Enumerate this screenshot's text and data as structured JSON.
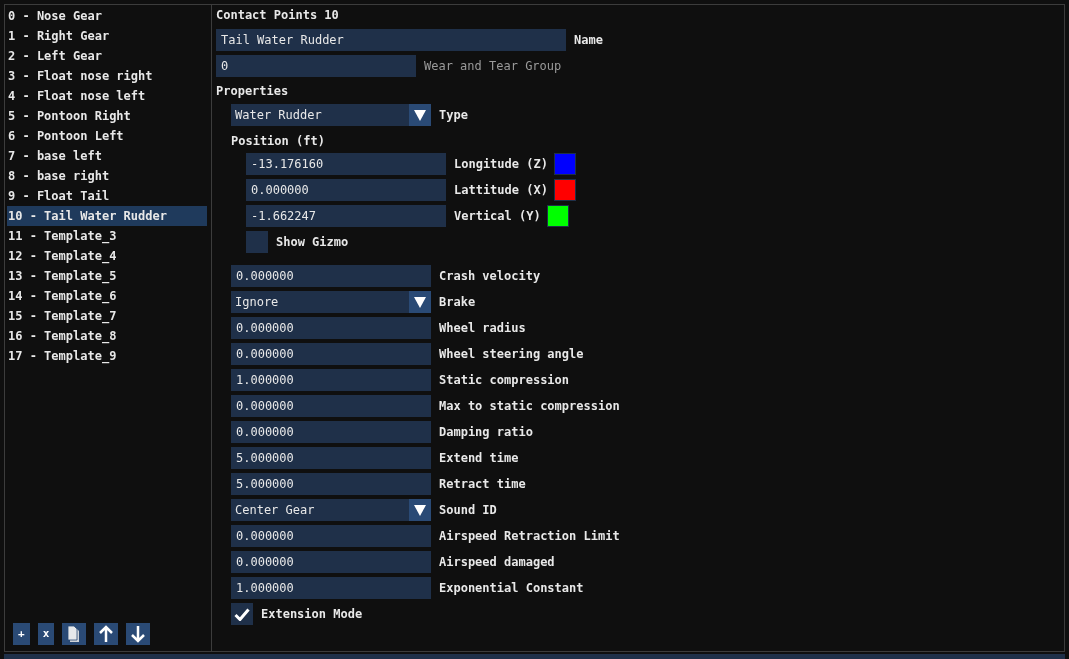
{
  "contact_list": {
    "items": [
      {
        "label": "0 - Nose Gear",
        "selected": false
      },
      {
        "label": "1 - Right Gear",
        "selected": false
      },
      {
        "label": "2 - Left Gear",
        "selected": false
      },
      {
        "label": "3 - Float nose right",
        "selected": false
      },
      {
        "label": "4 - Float nose left",
        "selected": false
      },
      {
        "label": "5 - Pontoon Right",
        "selected": false
      },
      {
        "label": "6 - Pontoon Left",
        "selected": false
      },
      {
        "label": "7 - base left",
        "selected": false
      },
      {
        "label": "8 - base right",
        "selected": false
      },
      {
        "label": "9 - Float Tail",
        "selected": false
      },
      {
        "label": "10 - Tail Water Rudder",
        "selected": true
      },
      {
        "label": "11 - Template_3",
        "selected": false
      },
      {
        "label": "12 - Template_4",
        "selected": false
      },
      {
        "label": "13 - Template_5",
        "selected": false
      },
      {
        "label": "14 - Template_6",
        "selected": false
      },
      {
        "label": "15 - Template_7",
        "selected": false
      },
      {
        "label": "16 - Template_8",
        "selected": false
      },
      {
        "label": "17 - Template_9",
        "selected": false
      }
    ],
    "buttons": [
      {
        "kind": "text",
        "label": "+"
      },
      {
        "kind": "text",
        "label": "x"
      },
      {
        "kind": "copy"
      },
      {
        "kind": "up"
      },
      {
        "kind": "down"
      }
    ]
  },
  "editor": {
    "title": "Contact Points 10",
    "name": {
      "value": "Tail Water Rudder",
      "label": "Name"
    },
    "wear_group": {
      "value": "0",
      "label": "Wear and Tear Group",
      "disabled": true
    },
    "properties_heading": "Properties",
    "type": {
      "value": "Water Rudder",
      "label": "Type"
    },
    "position": {
      "heading": "Position (ft)",
      "axes": [
        {
          "value": "-13.176160",
          "label": "Longitude (Z)",
          "color": "#0000ff"
        },
        {
          "value": "0.000000",
          "label": "Lattitude (X)",
          "color": "#ff0000"
        },
        {
          "value": "-1.662247",
          "label": "Vertical (Y)",
          "color": "#00ff00"
        }
      ],
      "show_gizmo": {
        "label": "Show Gizmo",
        "checked": false
      }
    },
    "fields": [
      {
        "kind": "number",
        "value": "0.000000",
        "label": "Crash velocity"
      },
      {
        "kind": "dropdown",
        "value": "Ignore",
        "label": "Brake"
      },
      {
        "kind": "number",
        "value": "0.000000",
        "label": "Wheel radius"
      },
      {
        "kind": "number",
        "value": "0.000000",
        "label": "Wheel steering angle"
      },
      {
        "kind": "number",
        "value": "1.000000",
        "label": "Static compression"
      },
      {
        "kind": "number",
        "value": "0.000000",
        "label": "Max to static compression"
      },
      {
        "kind": "number",
        "value": "0.000000",
        "label": "Damping ratio"
      },
      {
        "kind": "number",
        "value": "5.000000",
        "label": "Extend time"
      },
      {
        "kind": "number",
        "value": "5.000000",
        "label": "Retract time"
      },
      {
        "kind": "dropdown",
        "value": "Center Gear",
        "label": "Sound ID"
      },
      {
        "kind": "number",
        "value": "0.000000",
        "label": "Airspeed Retraction Limit"
      },
      {
        "kind": "number",
        "value": "0.000000",
        "label": "Airspeed damaged"
      },
      {
        "kind": "number",
        "value": "1.000000",
        "label": "Exponential Constant"
      }
    ],
    "extension_mode": {
      "label": "Extension Mode",
      "checked": true
    }
  }
}
